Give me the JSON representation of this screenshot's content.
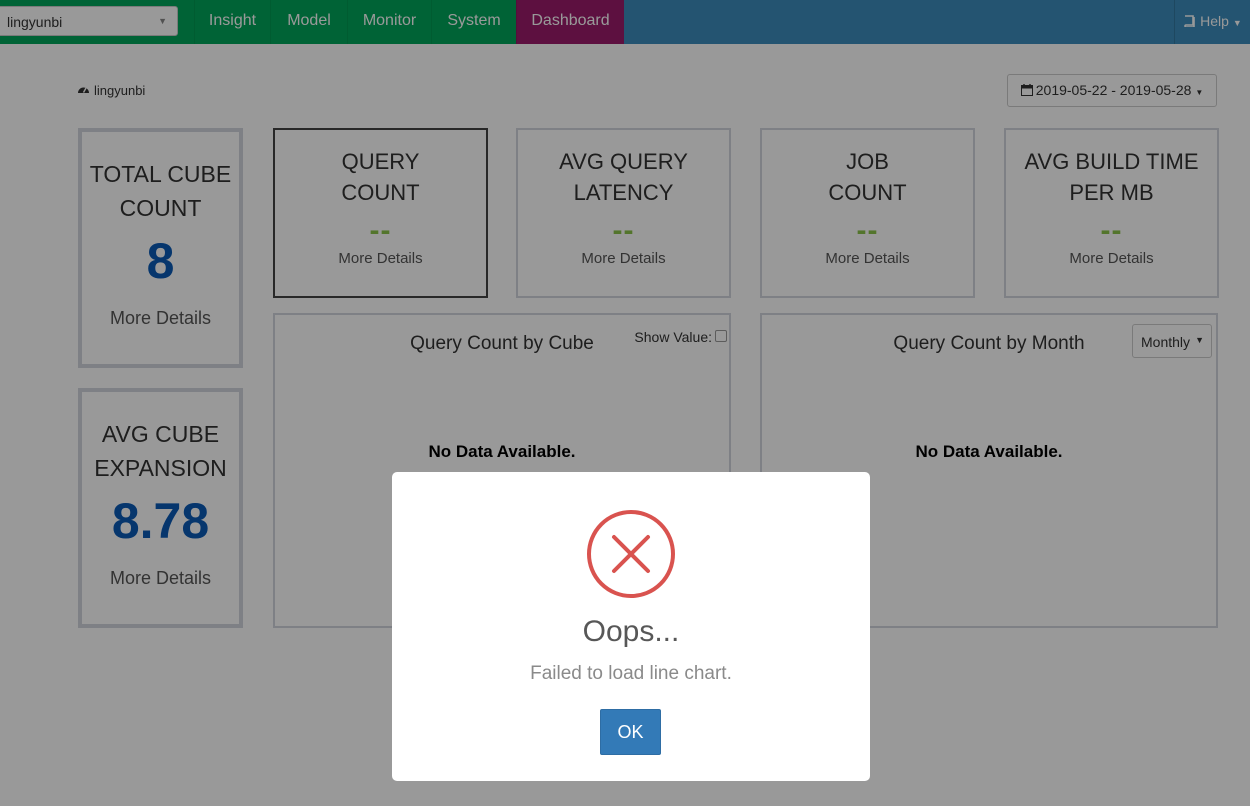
{
  "navbar": {
    "project": "lingyunbi",
    "items": [
      {
        "label": "Insight"
      },
      {
        "label": "Model"
      },
      {
        "label": "Monitor"
      },
      {
        "label": "System"
      },
      {
        "label": "Dashboard"
      }
    ],
    "active": "Dashboard",
    "help": "Help",
    "colors": {
      "bar": "#3c8dbc",
      "left": "#00a65a",
      "active": "#9b1b6b"
    }
  },
  "page": {
    "project_label": "lingyunbi",
    "date_range": "2019-05-22 - 2019-05-28"
  },
  "metrics": {
    "total_cube": {
      "title_line1": "TOTAL CUBE",
      "title_line2": "COUNT",
      "value": "8",
      "more": "More Details"
    },
    "avg_expansion": {
      "title_line1": "AVG CUBE",
      "title_line2": "EXPANSION",
      "value": "8.78",
      "more": "More Details"
    },
    "query_count": {
      "title_line1": "QUERY",
      "title_line2": "COUNT",
      "value": "--",
      "more": "More Details"
    },
    "avg_latency": {
      "title_line1": "AVG QUERY",
      "title_line2": "LATENCY",
      "value": "--",
      "more": "More Details"
    },
    "job_count": {
      "title_line1": "JOB",
      "title_line2": "COUNT",
      "value": "--",
      "more": "More Details"
    },
    "avg_build": {
      "title_line1": "AVG BUILD TIME",
      "title_line2": "PER MB",
      "value": "--",
      "more": "More Details"
    }
  },
  "charts": {
    "by_cube": {
      "title": "Query Count by Cube",
      "show_value": "Show Value:",
      "no_data": "No Data Available."
    },
    "by_month": {
      "title": "Query Count by Month",
      "period": "Monthly",
      "no_data": "No Data Available."
    }
  },
  "modal": {
    "icon": "error-x-icon",
    "title": "Oops...",
    "message": "Failed to load line chart.",
    "ok": "OK",
    "icon_color": "#d9534f"
  }
}
